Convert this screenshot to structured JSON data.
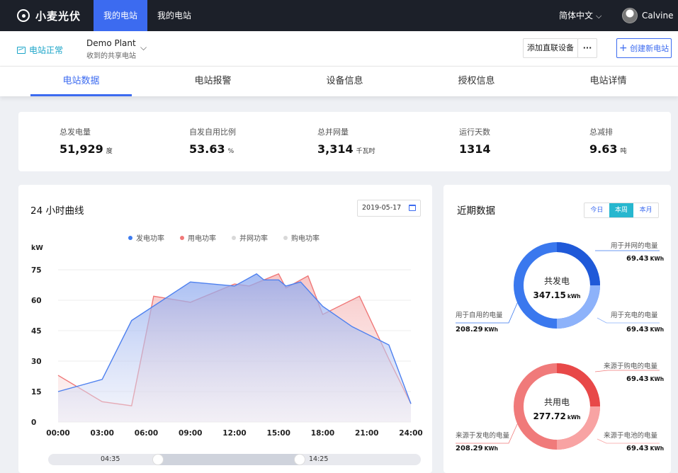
{
  "app": {
    "name": "小麦光伏"
  },
  "nav": {
    "tabs": [
      "我的电站",
      "我的电站"
    ]
  },
  "topbar": {
    "language": "简体中文",
    "user": "Calvine"
  },
  "subheader": {
    "status": "电站正常",
    "plant_name": "Demo Plant",
    "plant_sub": "收到的共享电站",
    "add_device": "添加直联设备",
    "more": "···",
    "create_plant": "创建新电站"
  },
  "tabs": [
    "电站数据",
    "电站报警",
    "设备信息",
    "授权信息",
    "电站详情"
  ],
  "stats": [
    {
      "label": "总发电量",
      "value": "51,929",
      "unit": "度"
    },
    {
      "label": "自发自用比例",
      "value": "53.63",
      "unit": "%"
    },
    {
      "label": "总并网量",
      "value": "3,314",
      "unit": "千瓦时"
    },
    {
      "label": "运行天数",
      "value": "1314",
      "unit": ""
    },
    {
      "label": "总减排",
      "value": "9.63",
      "unit": "吨"
    }
  ],
  "curve": {
    "title": "24 小时曲线",
    "date": "2019-05-17",
    "slider_start": "04:35",
    "slider_end": "14:25"
  },
  "colors": {
    "accent": "#3c6bf0",
    "gen": "#5b8ff5",
    "use": "#f08585",
    "grid_export": "#cccccc",
    "buy": "#d5d5d5",
    "teal": "#27b7cf"
  },
  "chart_data": {
    "type": "area",
    "ylabel": "kW",
    "ylim": [
      0,
      75
    ],
    "yticks": [
      0,
      15,
      30,
      45,
      60,
      75
    ],
    "xticks": [
      "00:00",
      "03:00",
      "06:00",
      "09:00",
      "12:00",
      "15:00",
      "18:00",
      "21:00",
      "24:00"
    ],
    "legend": "top",
    "series": [
      {
        "name": "发电功率",
        "x": [
          0,
          3,
          5,
          9,
          12,
          13.5,
          14,
          15,
          15.5,
          16.5,
          18,
          20,
          22.5,
          24
        ],
        "values": [
          15,
          21,
          50,
          69,
          67,
          73,
          70,
          70,
          67,
          69,
          57,
          47,
          38,
          9
        ]
      },
      {
        "name": "用电功率",
        "x": [
          0,
          3,
          5,
          6.5,
          9,
          12,
          13,
          15,
          15.5,
          17,
          18,
          20.5,
          22.5,
          24
        ],
        "values": [
          23,
          10,
          8,
          62,
          59,
          68,
          67,
          73,
          66,
          72,
          53,
          62,
          31,
          9
        ]
      },
      {
        "name": "并网功率",
        "x": [],
        "values": []
      },
      {
        "name": "购电功率",
        "x": [],
        "values": []
      }
    ]
  },
  "recent": {
    "title": "近期数据",
    "seg": [
      "今日",
      "本周",
      "本月"
    ],
    "gen_donut": {
      "title": "共发电",
      "total": "347.15",
      "unit": "kWh",
      "a_label": "用于并网的电量",
      "a_value": "69.43",
      "b_label": "用于自用的电量",
      "b_value": "208.29",
      "c_label": "用于充电的电量",
      "c_value": "69.43",
      "vunit": "KWh"
    },
    "use_donut": {
      "title": "共用电",
      "total": "277.72",
      "unit": "kWh",
      "a_label": "来源于购电的电量",
      "a_value": "69.43",
      "b_label": "来源于发电的电量",
      "b_value": "208.29",
      "c_label": "来源于电池的电量",
      "c_value": "69.43",
      "vunit": "KWh"
    }
  }
}
